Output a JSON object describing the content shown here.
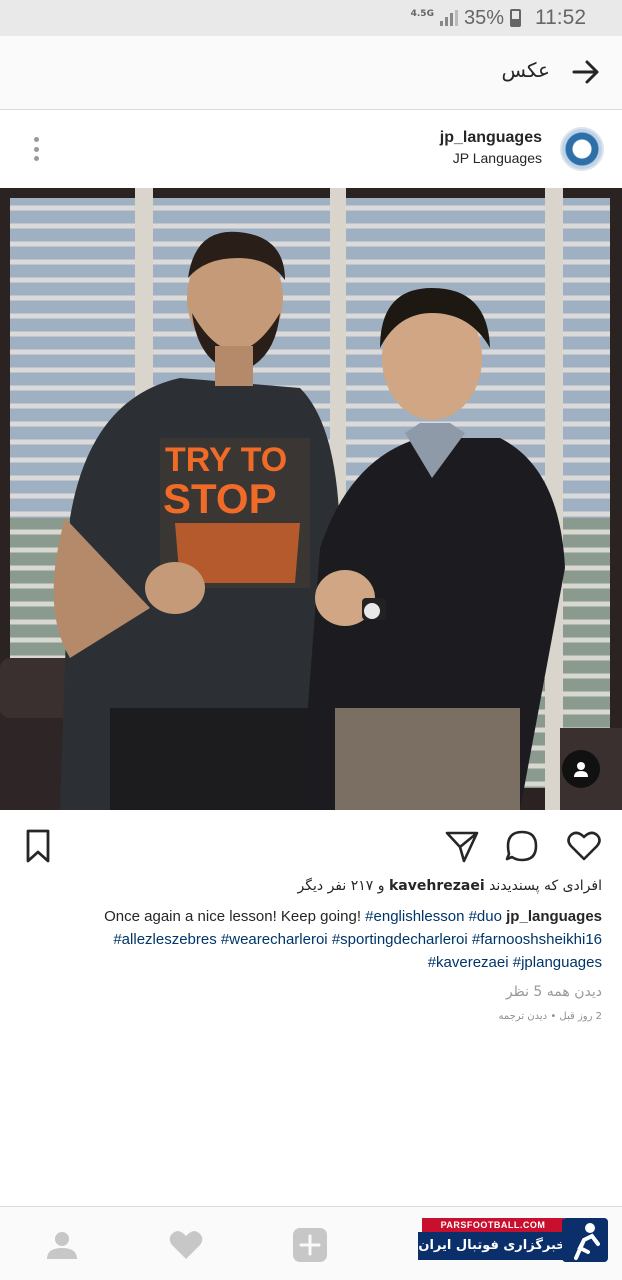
{
  "status_bar": {
    "network": "4.5G",
    "battery": "35%",
    "time": "11:52"
  },
  "header": {
    "title": "عکس",
    "back_icon": "arrow-right-icon"
  },
  "post": {
    "username": "jp_languages",
    "display_name": "JP Languages",
    "more_icon": "more-vertical-icon",
    "photo_text": [
      "TRY TO",
      "STOP"
    ],
    "likes_prefix": "افرادی که پسندیدند",
    "likes_user": "kavehrezaei",
    "likes_suffix": "و ۲۱۷ نفر دیگر",
    "caption_user": "jp_languages",
    "caption_text": "Once again a nice lesson! Keep going!",
    "hashtags": [
      "#englishlesson",
      "#duo",
      "#allezleszebres",
      "#wearecharleroi",
      "#sportingdecharleroi",
      "#farnooshsheikhi16",
      "#kaverezaei",
      "#jplanguages"
    ],
    "view_comments_prefix": "دیدن همه",
    "view_comments_count": "5",
    "view_comments_suffix": "نظر",
    "time_ago": "2 روز قبل",
    "dot": "•",
    "see_translation": "دیدن ترجمه"
  },
  "actions": {
    "icons": [
      "like-icon",
      "comment-icon",
      "share-icon",
      "save-icon"
    ]
  },
  "bottom_nav": {
    "icons": [
      "profile-icon",
      "heart-icon",
      "add-icon",
      "search-icon",
      "home-icon"
    ]
  },
  "watermark": {
    "top": "PARSFOOTBALL.COM",
    "bottom": "خبرگزاری فوتبال ایران"
  },
  "colors": {
    "hashtag": "#003569",
    "watermark_red": "#c8102e",
    "watermark_blue": "#0a2f6b"
  }
}
